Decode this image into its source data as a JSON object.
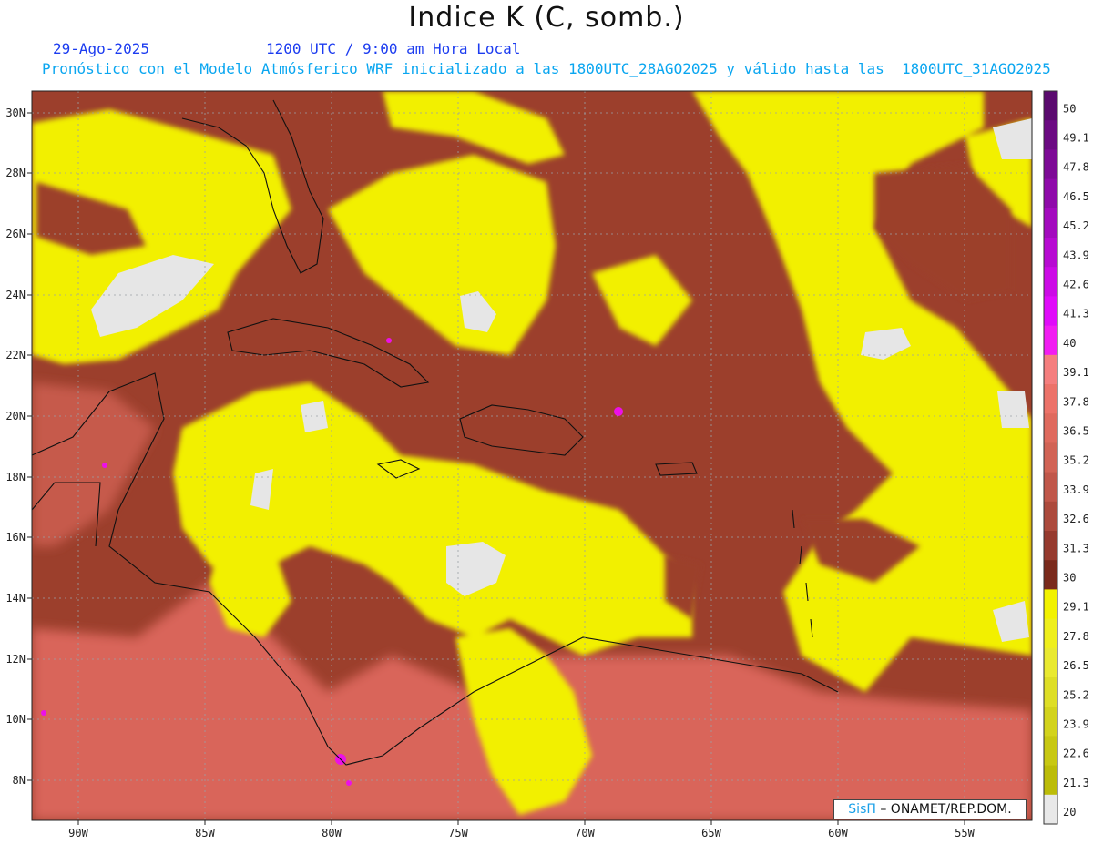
{
  "header": {
    "title": "Indice K (C, somb.)",
    "date": "29-Ago-2025",
    "time": "1200 UTC / 9:00 am Hora Local",
    "model_info": "Pronóstico con el Modelo Atmósferico WRF inicializado a las 1800UTC_28AGO2025 y válido hasta las  1800UTC_31AGO2025"
  },
  "map": {
    "region": "Caribbean / Gulf of Mexico",
    "lon_labels": [
      "90W",
      "85W",
      "80W",
      "75W",
      "70W",
      "65W",
      "60W",
      "55W"
    ],
    "lat_labels": [
      "30N",
      "28N",
      "26N",
      "24N",
      "22N",
      "20N",
      "18N",
      "16N",
      "14N",
      "12N",
      "10N",
      "8N"
    ],
    "grid": "dotted"
  },
  "colorbar": {
    "labels": [
      "50",
      "49.1",
      "47.8",
      "46.5",
      "45.2",
      "43.9",
      "42.6",
      "41.3",
      "40",
      "39.1",
      "37.8",
      "36.5",
      "35.2",
      "33.9",
      "32.6",
      "31.3",
      "30",
      "29.1",
      "27.8",
      "26.5",
      "25.2",
      "23.9",
      "22.6",
      "21.3",
      "20"
    ],
    "colors": [
      "#5a0a6e",
      "#6b0a82",
      "#7d0a96",
      "#8f0aaa",
      "#a30abe",
      "#b70ad2",
      "#cc0ae6",
      "#e00afa",
      "#f11cf2",
      "#f47e7e",
      "#ec7269",
      "#df6a5e",
      "#d16355",
      "#c0574a",
      "#ac4a3c",
      "#963a2e",
      "#7a2a1c",
      "#f2f200",
      "#efef1c",
      "#e9e930",
      "#dede26",
      "#d3d31c",
      "#c8c812",
      "#bcbc08",
      "#e8e8e8"
    ]
  },
  "credit": {
    "brand": "SisΠ",
    "org": "– ONAMET/REP.DOM."
  }
}
